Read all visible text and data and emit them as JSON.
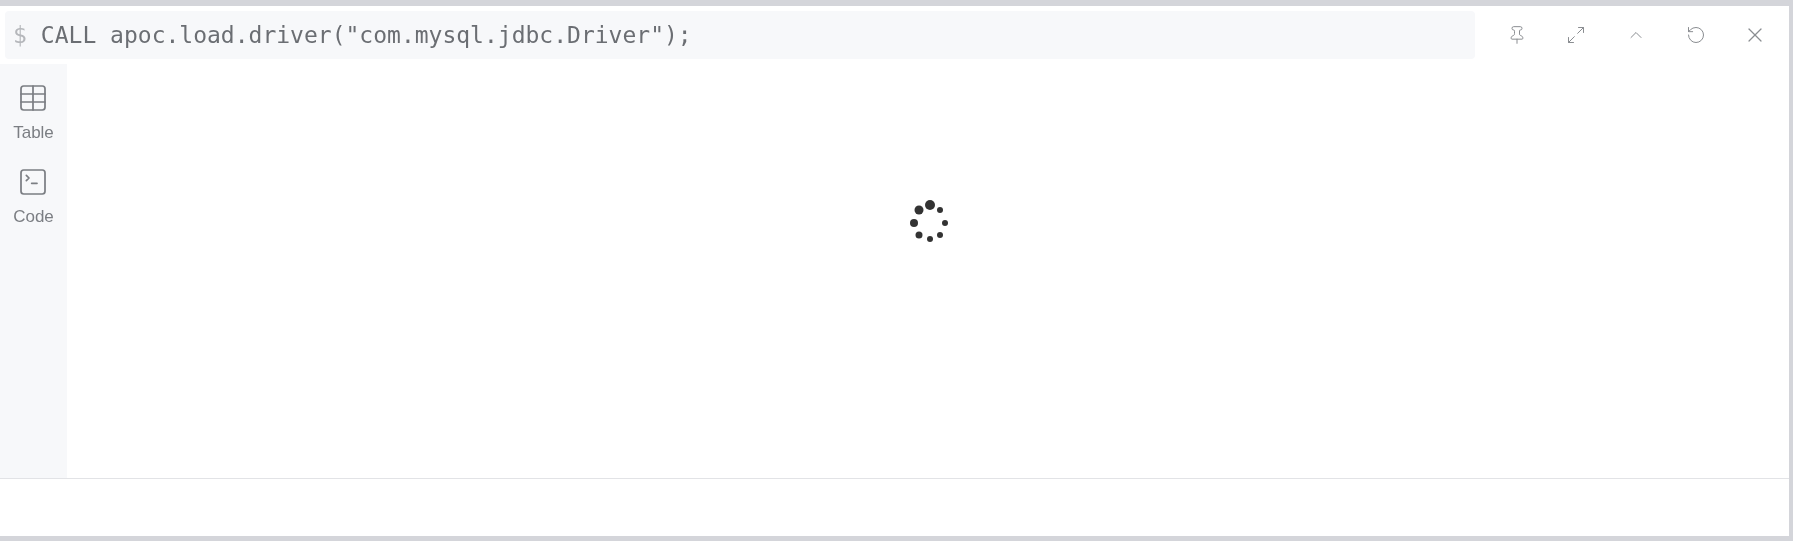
{
  "editor": {
    "prompt": "$",
    "query": "CALL apoc.load.driver(\"com.mysql.jdbc.Driver\");"
  },
  "sidebar": {
    "items": [
      {
        "label": "Table",
        "kind": "table"
      },
      {
        "label": "Code",
        "kind": "code"
      }
    ]
  },
  "toolbar": {
    "buttons": [
      {
        "kind": "pin"
      },
      {
        "kind": "expand"
      },
      {
        "kind": "collapse"
      },
      {
        "kind": "rerun"
      },
      {
        "kind": "close"
      }
    ]
  }
}
